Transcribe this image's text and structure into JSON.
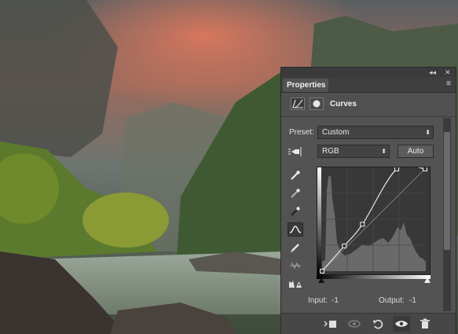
{
  "panel": {
    "tab_label": "Properties",
    "window_controls": {
      "collapse": "◂◂",
      "close": "✕"
    },
    "title": "Curves",
    "preset_label": "Preset:",
    "preset_value": "Custom",
    "channel_value": "RGB",
    "auto_label": "Auto",
    "input_label": "Input:",
    "input_value": "-1",
    "output_label": "Output:",
    "output_value": "-1"
  },
  "curve": {
    "points": [
      [
        0,
        0
      ],
      [
        55,
        63
      ],
      [
        100,
        117
      ],
      [
        185,
        255
      ],
      [
        255,
        255
      ]
    ]
  },
  "tools": [
    "on-image-adjust-icon",
    "white-eyedropper-icon",
    "gray-eyedropper-icon",
    "black-eyedropper-icon",
    "curve-point-icon",
    "pencil-icon",
    "smooth-icon",
    "clipping-warning-icon"
  ],
  "footer_icons": [
    "clip-to-layer-icon",
    "view-previous-icon",
    "reset-icon",
    "visibility-eye-icon",
    "delete-icon"
  ],
  "colors": {
    "panel_bg": "#535353",
    "dark_bg": "#383838",
    "curve": "#e6e6e6"
  }
}
